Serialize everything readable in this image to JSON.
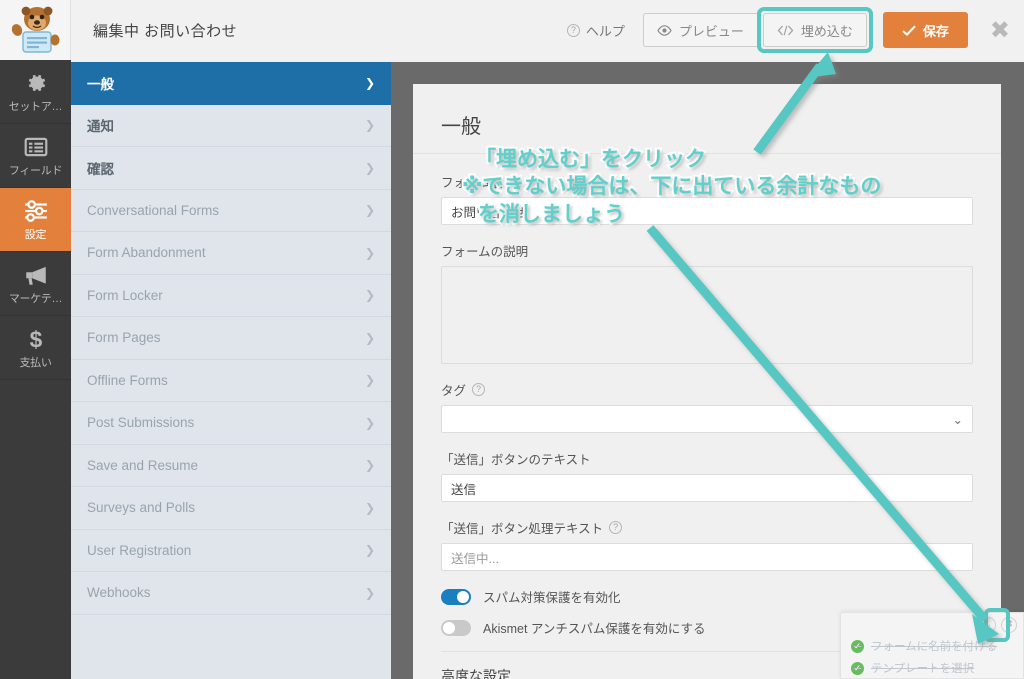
{
  "header": {
    "logo_icon": "beaver-mascot-logo",
    "title": "編集中 お問い合わせ",
    "help_label": "ヘルプ",
    "help_icon": "question-circle-icon",
    "preview_label": "プレビュー",
    "preview_icon": "eye-icon",
    "embed_label": "埋め込む",
    "embed_icon": "code-brackets-icon",
    "save_label": "保存",
    "save_icon": "check-icon",
    "close_icon": "close-x-icon",
    "accent_orange": "#e2803c",
    "highlight_teal": "#57c7c2"
  },
  "rail": {
    "items": [
      {
        "label": "セットア…",
        "icon": "gear-icon",
        "active": false
      },
      {
        "label": "フィールド",
        "icon": "fields-list-icon",
        "active": false
      },
      {
        "label": "設定",
        "icon": "sliders-icon",
        "active": true
      },
      {
        "label": "マーケテ…",
        "icon": "megaphone-icon",
        "active": false
      },
      {
        "label": "支払い",
        "icon": "dollar-sign-icon",
        "active": false
      }
    ]
  },
  "settings_list": {
    "chevron_icon": "chevron-right-icon",
    "items": [
      {
        "label": "一般",
        "state": "active"
      },
      {
        "label": "通知",
        "state": "enabled"
      },
      {
        "label": "確認",
        "state": "enabled"
      },
      {
        "label": "Conversational Forms",
        "state": "disabled"
      },
      {
        "label": "Form Abandonment",
        "state": "disabled"
      },
      {
        "label": "Form Locker",
        "state": "disabled"
      },
      {
        "label": "Form Pages",
        "state": "disabled"
      },
      {
        "label": "Offline Forms",
        "state": "disabled"
      },
      {
        "label": "Post Submissions",
        "state": "disabled"
      },
      {
        "label": "Save and Resume",
        "state": "disabled"
      },
      {
        "label": "Surveys and Polls",
        "state": "disabled"
      },
      {
        "label": "User Registration",
        "state": "disabled"
      },
      {
        "label": "Webhooks",
        "state": "disabled"
      }
    ]
  },
  "panel": {
    "title": "一般",
    "form_name": {
      "label": "フォーム名",
      "value": "お問い合わせ"
    },
    "form_description": {
      "label": "フォームの説明",
      "value": ""
    },
    "tags": {
      "label": "タグ",
      "help_icon": "question-circle-icon",
      "value": "",
      "chevron_icon": "chevron-down-icon"
    },
    "submit_button_text": {
      "label": "「送信」ボタンのテキスト",
      "value": "送信"
    },
    "submit_processing_text": {
      "label": "「送信」ボタン処理テキスト",
      "help_icon": "question-circle-icon",
      "value": "送信中..."
    },
    "toggles": [
      {
        "label": "スパム対策保護を有効化",
        "on": true
      },
      {
        "label": "Akismet アンチスパム保護を有効にする",
        "on": false
      }
    ],
    "advanced_label": "高度な設定"
  },
  "annotation": {
    "line1": "「埋め込む」をクリック",
    "line2": "※できない場合は、下に出ている余計なもの",
    "line3": "を消しましょう",
    "color": "#5fd0cb"
  },
  "checklist": {
    "collapse_icon": "chevron-down-circle-icon",
    "close_icon": "close-circle-icon",
    "items": [
      {
        "label": "フォームに名前を付ける",
        "done": true,
        "icon": "check-circle-icon"
      },
      {
        "label": "テンプレートを選択",
        "done": true,
        "icon": "check-circle-icon"
      }
    ]
  }
}
